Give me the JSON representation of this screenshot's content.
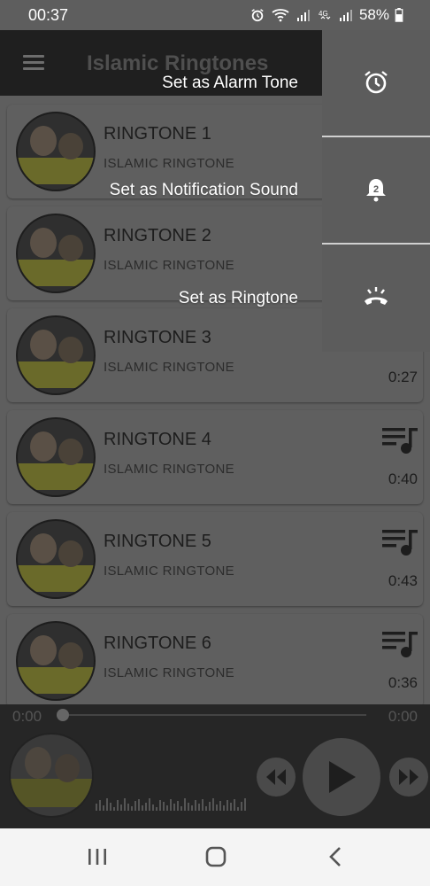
{
  "status": {
    "time": "00:37",
    "battery": "58%"
  },
  "app": {
    "title": "Islamic Ringtones"
  },
  "popup": {
    "alarm_label": "Set as Alarm Tone",
    "notification_label": "Set as Notification Sound",
    "ringtone_label": "Set as Ringtone",
    "notification_badge": "2"
  },
  "list": [
    {
      "title": "RINGTONE 1",
      "subtitle": "ISLAMIC RINGTONE",
      "duration": ""
    },
    {
      "title": "RINGTONE 2",
      "subtitle": "ISLAMIC RINGTONE",
      "duration": ""
    },
    {
      "title": "RINGTONE 3",
      "subtitle": "ISLAMIC RINGTONE",
      "duration": "0:27"
    },
    {
      "title": "RINGTONE 4",
      "subtitle": "ISLAMIC RINGTONE",
      "duration": "0:40"
    },
    {
      "title": "RINGTONE 5",
      "subtitle": "ISLAMIC RINGTONE",
      "duration": "0:43"
    },
    {
      "title": "RINGTONE 6",
      "subtitle": "ISLAMIC RINGTONE",
      "duration": "0:36"
    }
  ],
  "player": {
    "elapsed": "0:00",
    "total": "0:00",
    "progress": 0
  },
  "icons": {
    "menu": "hamburger-icon",
    "alarm": "alarm-clock-icon",
    "notification": "bell-icon",
    "ringtone": "ringing-phone-icon",
    "playlist": "playlist-music-icon",
    "rewind": "rewind-icon",
    "play": "play-icon",
    "forward": "fast-forward-icon"
  }
}
